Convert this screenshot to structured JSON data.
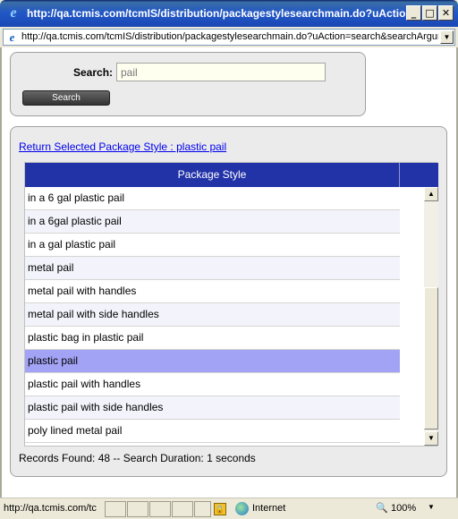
{
  "window": {
    "title": "http://qa.tcmis.com/tcmIS/distribution/packagestylesearchmain.do?uAction...",
    "address": "http://qa.tcmis.com/tcmIS/distribution/packagestylesearchmain.do?uAction=search&searchArgument"
  },
  "search": {
    "label": "Search:",
    "value": "pail",
    "button_label": "Search"
  },
  "results": {
    "return_link": "Return Selected Package Style : plastic pail",
    "column_header": "Package Style",
    "rows": [
      "in a 6 gal plastic pail",
      "in a 6gal plastic pail",
      "in a gal plastic pail",
      "metal pail",
      "metal pail with handles",
      "metal pail with side handles",
      "plastic bag in plastic pail",
      "plastic pail",
      "plastic pail with handles",
      "plastic pail with side handles",
      "poly lined metal pail"
    ],
    "selected_row": "plastic pail",
    "records_text": "Records Found: 48 -- Search Duration: 1 seconds"
  },
  "statusbar": {
    "url": "http://qa.tcmis.com/tc",
    "zone": "Internet",
    "zoom": "100%"
  },
  "colors": {
    "header_bg": "#2233a8",
    "selected_row": "#a3a3f5",
    "link": "#0000ee"
  },
  "icons": [
    "ie-logo-icon",
    "minimize-icon",
    "maximize-icon",
    "close-icon",
    "dropdown-arrow-icon",
    "scroll-up-icon",
    "scroll-down-icon",
    "lock-icon",
    "globe-icon",
    "zoom-icon"
  ]
}
